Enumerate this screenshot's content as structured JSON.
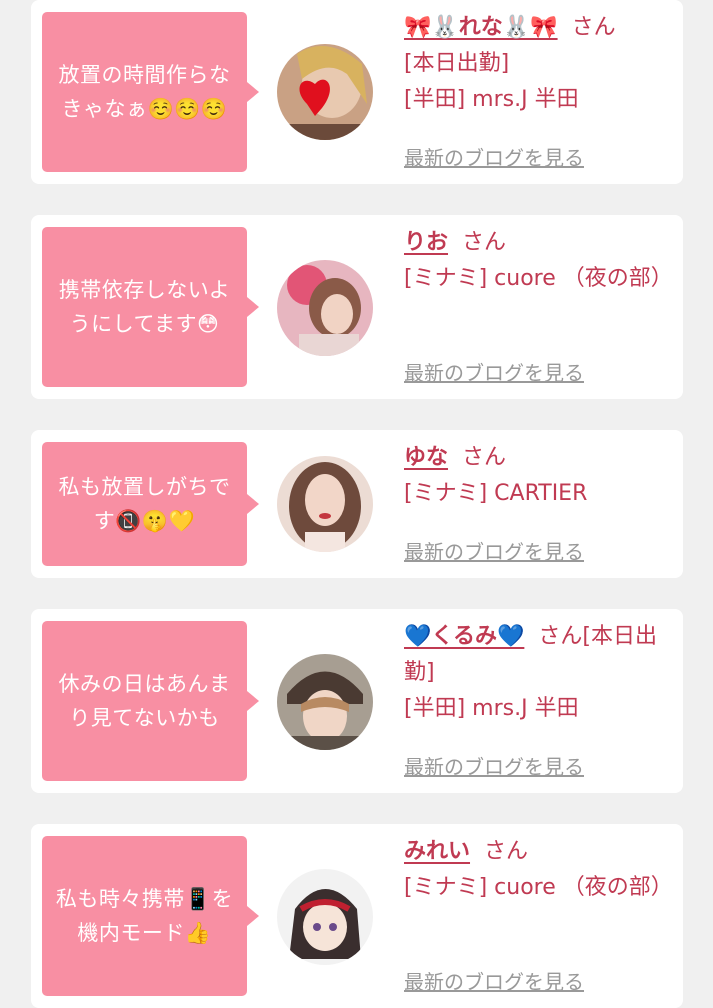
{
  "colors": {
    "accent": "#c03a52",
    "bubble": "#f88fa3",
    "background": "#f0f0f0",
    "link_gray": "#999999"
  },
  "cards": [
    {
      "message": "放置の時間作らなきゃなぁ☺️☺️☺️",
      "name": "🎀🐰れな🐰🎀",
      "honorific": "さん",
      "line1": "[本日出勤]",
      "line2": "[半田] mrs.J 半田",
      "blog_link": "最新のブログを見る"
    },
    {
      "message": "携帯依存しないようにしてます😳",
      "name": "りお",
      "honorific": "さん",
      "line1": "[ミナミ] cuore （夜の部）",
      "line2": "",
      "blog_link": "最新のブログを見る"
    },
    {
      "message": "私も放置しがちです📵🤫💛",
      "name": "ゆな",
      "honorific": "さん",
      "line1": "[ミナミ] CARTIER",
      "line2": "",
      "blog_link": "最新のブログを見る"
    },
    {
      "message": "休みの日はあんまり見てないかも",
      "name": "💙くるみ💙",
      "honorific": "さん[本日出勤]",
      "line1": "[半田] mrs.J 半田",
      "line2": "",
      "blog_link": "最新のブログを見る"
    },
    {
      "message": "私も時々携帯📱を機内モード👍",
      "name": "みれい",
      "honorific": "さん",
      "line1": "[ミナミ] cuore （夜の部）",
      "line2": "",
      "blog_link": "最新のブログを見る"
    }
  ]
}
